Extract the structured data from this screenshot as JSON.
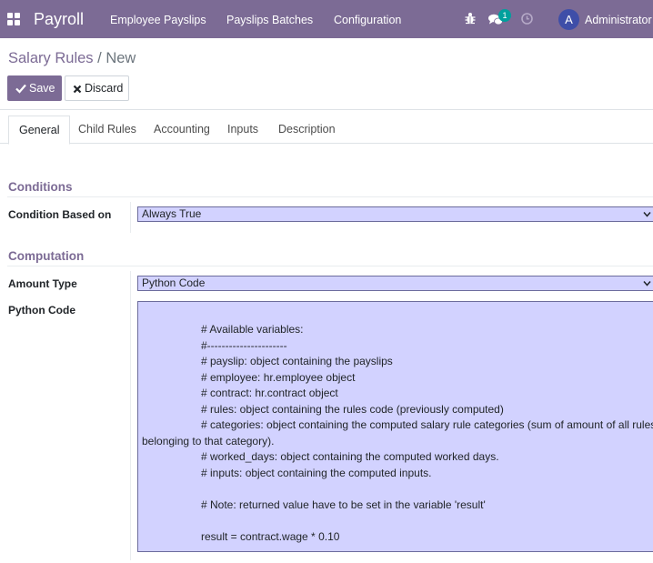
{
  "navbar": {
    "app_title": "Payroll",
    "menu": [
      "Employee Payslips",
      "Payslips Batches",
      "Configuration"
    ],
    "chat_badge": "1",
    "avatar_letter": "A",
    "user_name": "Administrator ("
  },
  "breadcrumb": {
    "parent": "Salary Rules",
    "separator": "/",
    "current": "New"
  },
  "buttons": {
    "save": "Save",
    "discard": "Discard"
  },
  "tabs": [
    "General",
    "Child Rules",
    "Accounting",
    "Inputs",
    "Description"
  ],
  "conditions": {
    "title": "Conditions",
    "condition_label": "Condition Based on",
    "condition_value": "Always True"
  },
  "computation": {
    "title": "Computation",
    "amount_type_label": "Amount Type",
    "amount_type_value": "Python Code",
    "python_code_label": "Python Code",
    "code_lines": [
      "# Available variables:",
      "#----------------------",
      "# payslip: object containing the payslips",
      "# employee: hr.employee object",
      "# contract: hr.contract object",
      "# rules: object containing the rules code (previously computed)",
      "# categories: object containing the computed salary rule categories (sum of amount of all rules",
      "belonging to that category).",
      "# worked_days: object containing the computed worked days.",
      "# inputs: object containing the computed inputs.",
      "# Note: returned value have to be set in the variable 'result'",
      "result = contract.wage * 0.10"
    ]
  },
  "colors": {
    "brand": "#7c6b95",
    "field_bg": "#d2d2ff",
    "badge": "#00a09d",
    "avatar": "#3e4ea8"
  }
}
